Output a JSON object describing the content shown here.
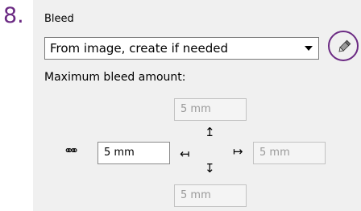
{
  "step": {
    "number": "8."
  },
  "bleed": {
    "title": "Bleed",
    "mode_selected": "From image, create if needed",
    "max_label": "Maximum bleed amount:",
    "top": "5 mm",
    "left": "5 mm",
    "right": "5 mm",
    "bottom": "5 mm"
  },
  "icons": {
    "link": "link-icon",
    "edit": "pencil-icon",
    "arrow_up": "↥",
    "arrow_down": "↧",
    "arrow_left": "↤",
    "arrow_right": "↦"
  },
  "colors": {
    "accent": "#6b2a83",
    "panel": "#f0f0f0"
  }
}
